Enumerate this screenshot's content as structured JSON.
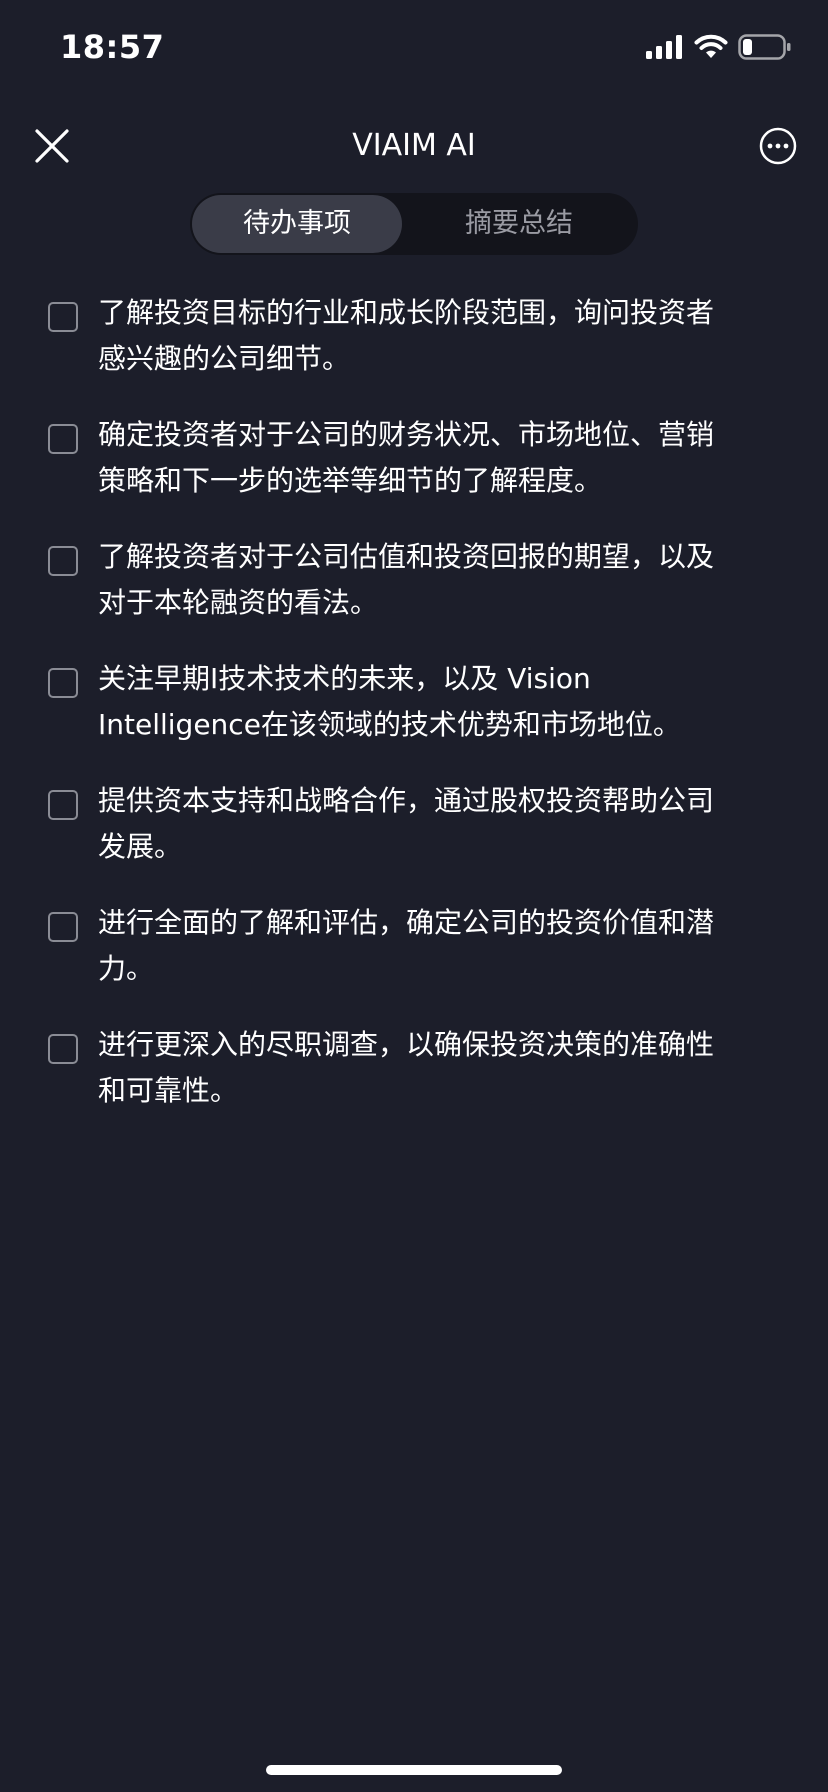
{
  "status_bar": {
    "time": "18:57",
    "icons": [
      "signal-icon",
      "wifi-icon",
      "battery-icon"
    ]
  },
  "nav": {
    "title": "VIAIM AI",
    "close_icon": "close-icon",
    "more_icon": "more-icon"
  },
  "tabs": [
    {
      "label": "待办事项",
      "active": true
    },
    {
      "label": "摘要总结",
      "active": false
    }
  ],
  "todos": [
    {
      "line1": "了解投资目标的行业和成长阶段范围，询问投资者",
      "line2": "感兴趣的公司细节。",
      "checked": false
    },
    {
      "line1": "确定投资者对于公司的财务状况、市场地位、营销",
      "line2": "策略和下一步的选举等细节的了解程度。",
      "checked": false
    },
    {
      "line1": "了解投资者对于公司估值和投资回报的期望，以及",
      "line2": "对于本轮融资的看法。",
      "checked": false
    },
    {
      "line1": "关注早期I技术技术的未来，以及 Vision",
      "line2": "Intelligence在该领域的技术优势和市场地位。",
      "checked": false
    },
    {
      "line1": "提供资本支持和战略合作，通过股权投资帮助公司",
      "line2": "发展。",
      "checked": false
    },
    {
      "line1": "进行全面的了解和评估，确定公司的投资价值和潜",
      "line2": "力。",
      "checked": false
    },
    {
      "line1": "进行更深入的尽职调查，以确保投资决策的准确性",
      "line2": "和可靠性。",
      "checked": false
    }
  ],
  "colors": {
    "background": "#1c1e2a",
    "tab_active": "#3a3c48",
    "tab_track": "#13141b",
    "checkbox_border": "#8a8c95"
  }
}
